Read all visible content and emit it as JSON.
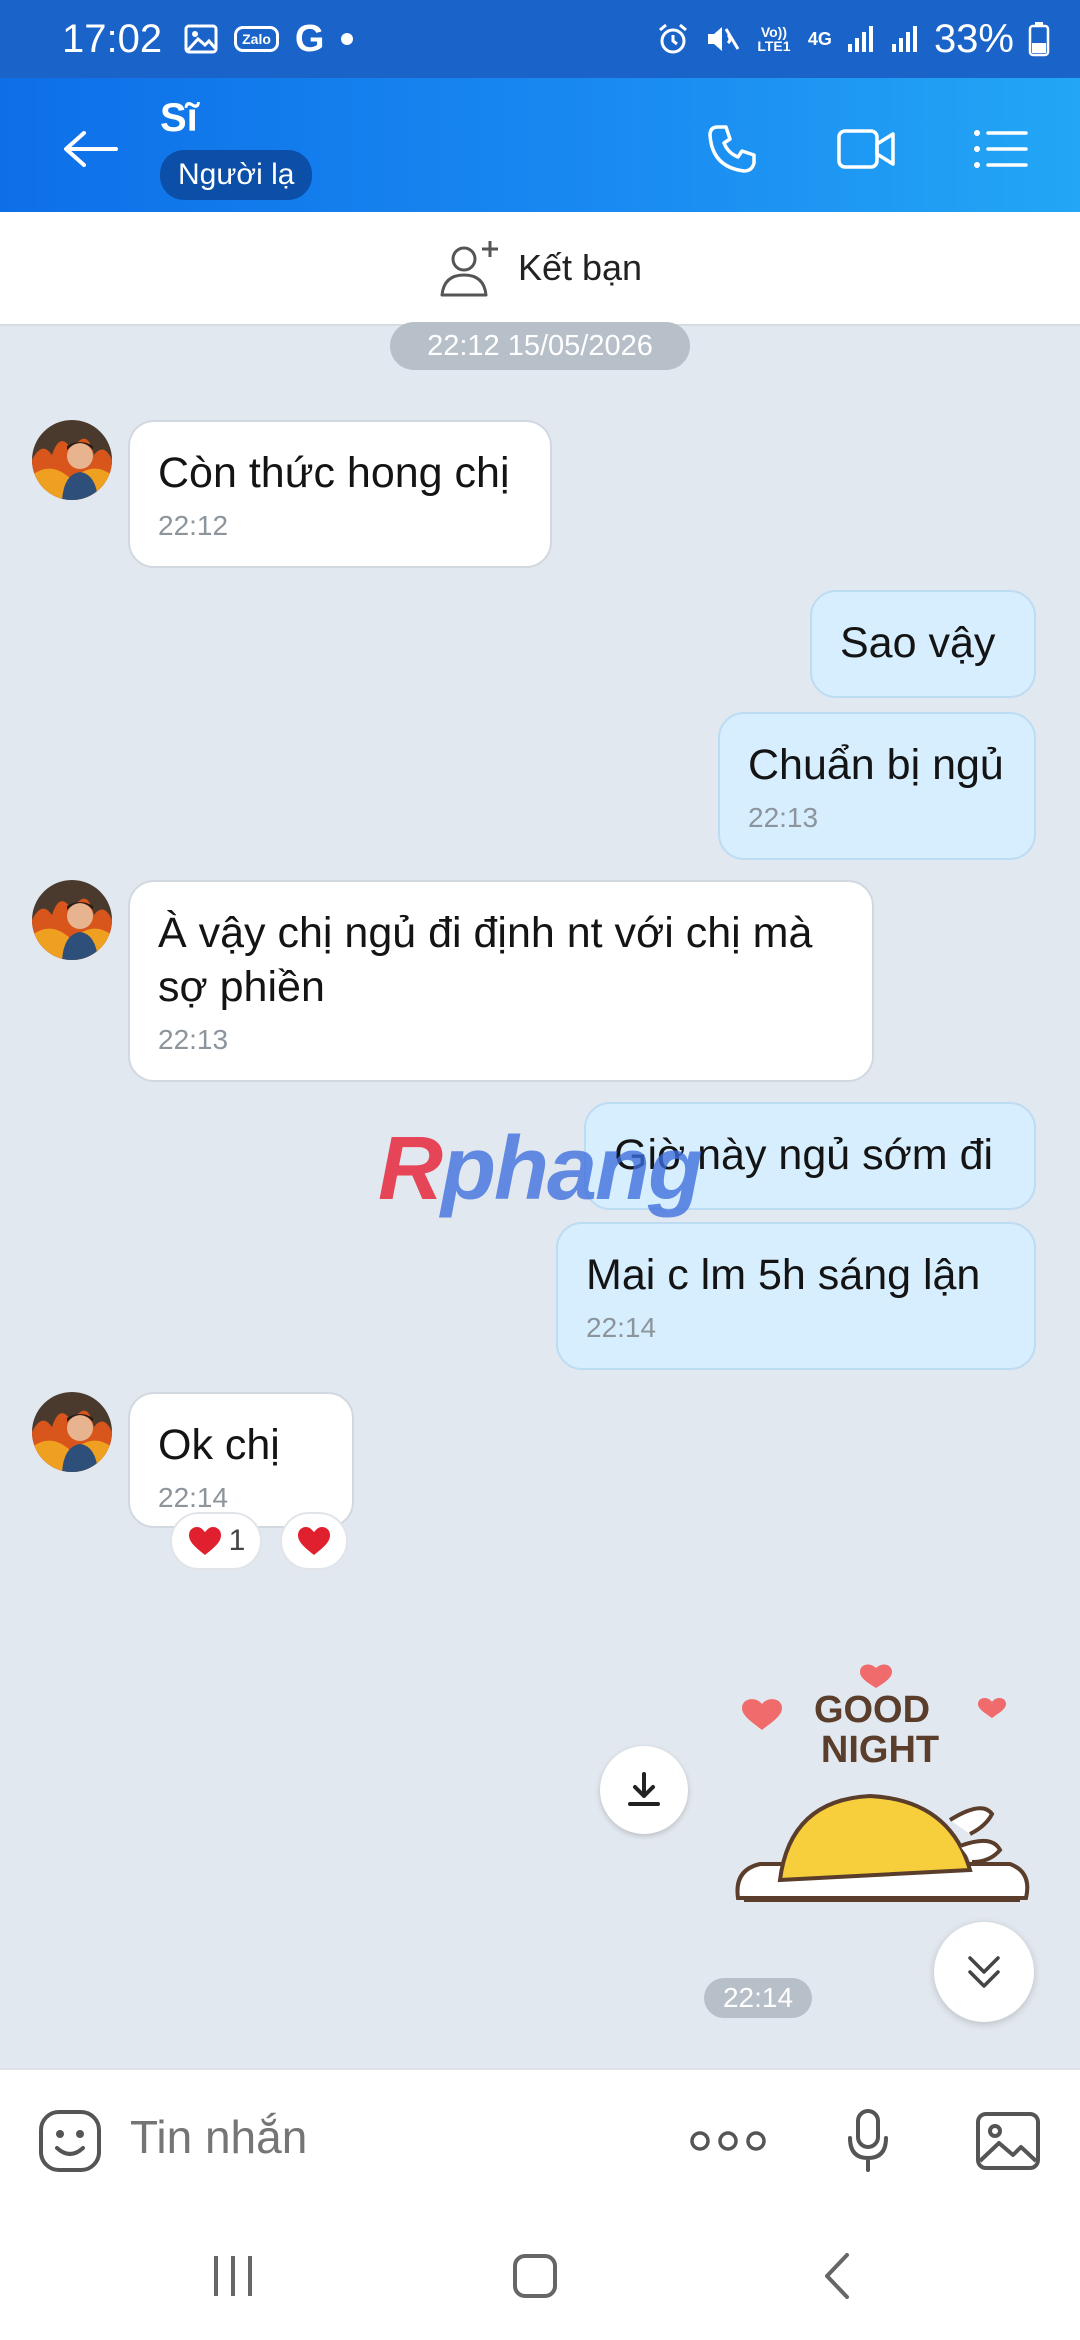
{
  "status_bar": {
    "time": "17:02",
    "left_icons": [
      "image-icon",
      "zalo-icon",
      "g-icon",
      "dot-icon"
    ],
    "zalo_label": "Zalo",
    "g_label": "G",
    "volte_label": "Vo)) LTE1",
    "net_label": "4G",
    "battery": "33%"
  },
  "header": {
    "contact_name": "Sĩ",
    "badge": "Người lạ"
  },
  "friend_bar": {
    "label": "Kết bạn"
  },
  "date_chip": "22:12 15/05/2026",
  "messages": [
    {
      "side": "in",
      "text": "Còn thức hong chị",
      "time": "22:12"
    },
    {
      "side": "out",
      "text": "Sao vậy"
    },
    {
      "side": "out",
      "text": "Chuẩn bị ngủ",
      "time": "22:13"
    },
    {
      "side": "in",
      "text": "À vậy chị ngủ đi định nt với chị mà sợ phiền",
      "time": "22:13"
    },
    {
      "side": "out",
      "text": "Giờ này  ngủ sớm đi"
    },
    {
      "side": "out",
      "text": "Mai c lm 5h  sáng lận",
      "time": "22:14"
    },
    {
      "side": "in",
      "text": "Ok chị",
      "time": "22:14"
    }
  ],
  "reactions": [
    {
      "icon": "heart-icon",
      "count": "1"
    },
    {
      "icon": "heart-icon",
      "count": ""
    }
  ],
  "watermark": {
    "first": "R",
    "rest": "phang"
  },
  "sticker": {
    "line1": "GOOD",
    "line2": "NIGHT",
    "time": "22:14"
  },
  "composer": {
    "placeholder": "Tin nhắn"
  },
  "colors": {
    "header_start": "#0d6fe8",
    "header_end": "#23a6f5",
    "outgoing_bubble": "#d7eefe",
    "incoming_bubble": "#ffffff",
    "chat_background": "#e2e8ef",
    "heart": "#e0202e"
  }
}
